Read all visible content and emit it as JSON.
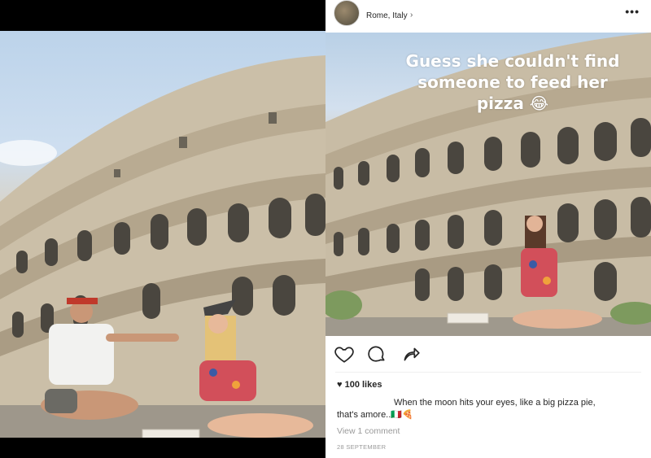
{
  "post": {
    "location": "Rome, Italy",
    "story_overlay_text": "Guess she couldn't find someone to feed her pizza 😂",
    "likes": "100 likes",
    "caption_line_1": "When the moon hits your eyes, like a big pizza pie,",
    "caption_line_2": "that's amore..🇮🇹🍕",
    "view_comments": "View 1 comment",
    "date": "28 SEPTEMBER"
  },
  "icons": {
    "more": "more-options-icon",
    "like": "heart-icon",
    "comment": "comment-icon",
    "share": "share-icon",
    "likes_heart": "heart-filled-icon",
    "chevron": "chevron-right-icon"
  },
  "colors": {
    "text": "#262626",
    "muted": "#9a9a9a",
    "divider": "#efefef"
  }
}
